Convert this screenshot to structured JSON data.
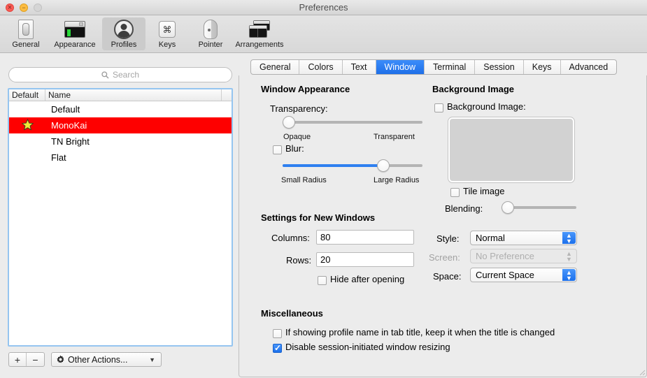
{
  "window": {
    "title": "Preferences",
    "controls": {
      "close": "close-button",
      "minimize": "minimize-button",
      "zoom": "zoom-button"
    }
  },
  "toolbar": {
    "items": [
      {
        "label": "General",
        "icon": "general-icon",
        "selected": false
      },
      {
        "label": "Appearance",
        "icon": "appearance-icon",
        "selected": false
      },
      {
        "label": "Profiles",
        "icon": "profiles-icon",
        "selected": true
      },
      {
        "label": "Keys",
        "icon": "keys-icon",
        "selected": false
      },
      {
        "label": "Pointer",
        "icon": "pointer-icon",
        "selected": false
      },
      {
        "label": "Arrangements",
        "icon": "arrangements-icon",
        "selected": false
      }
    ]
  },
  "sidebar": {
    "search": {
      "placeholder": "Search",
      "value": "",
      "icon": "search-icon"
    },
    "list": {
      "columns": [
        "Default",
        "Name"
      ],
      "rows": [
        {
          "name": "Default",
          "is_default": false,
          "selected": false
        },
        {
          "name": "MonoKai",
          "is_default": true,
          "selected": true
        },
        {
          "name": "TN Bright",
          "is_default": false,
          "selected": false
        },
        {
          "name": "Flat",
          "is_default": false,
          "selected": false
        }
      ]
    },
    "footer": {
      "add_label": "+",
      "remove_label": "−",
      "other_actions_label": "Other Actions...",
      "gear_icon": "gear-icon",
      "chevron_icon": "chevron-down-icon"
    }
  },
  "tabs": [
    {
      "label": "General",
      "active": false
    },
    {
      "label": "Colors",
      "active": false
    },
    {
      "label": "Text",
      "active": false
    },
    {
      "label": "Window",
      "active": true
    },
    {
      "label": "Terminal",
      "active": false
    },
    {
      "label": "Session",
      "active": false
    },
    {
      "label": "Keys",
      "active": false
    },
    {
      "label": "Advanced",
      "active": false
    }
  ],
  "window_appearance": {
    "title": "Window Appearance",
    "transparency": {
      "label": "Transparency:",
      "min_label": "Opaque",
      "max_label": "Transparent",
      "value": 0
    },
    "blur": {
      "label": "Blur:",
      "checked": false,
      "min_label": "Small Radius",
      "max_label": "Large Radius",
      "value": 72
    }
  },
  "new_windows": {
    "title": "Settings for New Windows",
    "columns_label": "Columns:",
    "columns_value": "80",
    "rows_label": "Rows:",
    "rows_value": "20",
    "hide_after_opening_label": "Hide after opening",
    "hide_after_opening_checked": false
  },
  "background_image": {
    "title": "Background Image",
    "checkbox_label": "Background Image:",
    "checkbox_checked": false,
    "image_well": "empty",
    "tile_label": "Tile image",
    "tile_checked": false,
    "blending_label": "Blending:",
    "blending_value": 0
  },
  "window_placement": {
    "style_label": "Style:",
    "style_value": "Normal",
    "screen_label": "Screen:",
    "screen_value": "No Preference",
    "screen_disabled": true,
    "space_label": "Space:",
    "space_value": "Current Space"
  },
  "miscellaneous": {
    "title": "Miscellaneous",
    "options": [
      {
        "label": "If showing profile name in tab title, keep it when the title is changed",
        "checked": false
      },
      {
        "label": "Disable session-initiated window resizing",
        "checked": true
      }
    ]
  },
  "colors": {
    "accent_blue": "#1c70ec",
    "selection_red": "#fe0000",
    "star_yellow": "#f2e73a",
    "window_bg": "#ececec"
  }
}
